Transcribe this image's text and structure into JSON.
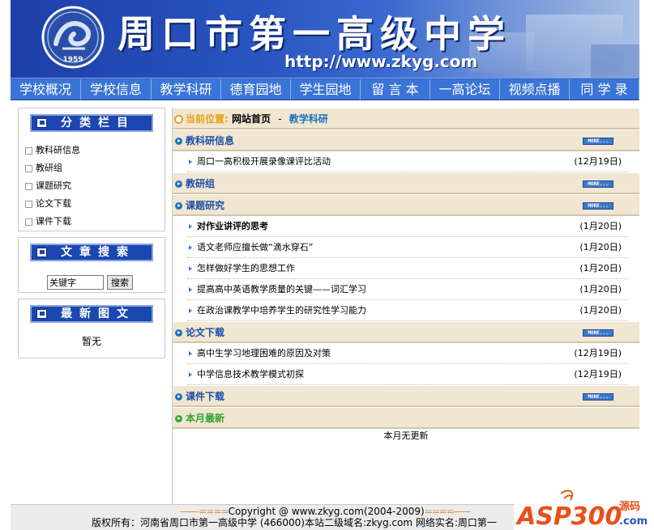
{
  "header": {
    "school_name": "周口市第一高级中学",
    "url": "http://www.zkyg.com",
    "logo_year": "1959"
  },
  "nav": {
    "items": [
      {
        "label": "学校概况"
      },
      {
        "label": "学校信息"
      },
      {
        "label": "教学科研"
      },
      {
        "label": "德育园地"
      },
      {
        "label": "学生园地"
      },
      {
        "label": "留 言 本"
      },
      {
        "label": "一高论坛"
      },
      {
        "label": "视频点播"
      },
      {
        "label": "同 学 录"
      }
    ]
  },
  "sidebar": {
    "categories": {
      "title": "分类栏目",
      "items": [
        "教科研信息",
        "教研组",
        "课题研究",
        "论文下载",
        "课件下载"
      ]
    },
    "search": {
      "title": "文章搜索",
      "input_value": "关键字",
      "button_label": "搜索"
    },
    "latest_images": {
      "title": "最新图文",
      "empty_text": "暂无"
    }
  },
  "main": {
    "location": {
      "label": "当前位置:",
      "home": "网站首页",
      "separator": "-",
      "current": "教学科研"
    },
    "more_label": "MORE...",
    "sections": [
      {
        "title": "教科研信息",
        "items": [
          {
            "title": "周口一高积极开展录像课评比活动",
            "date": "(12月19日)"
          }
        ]
      },
      {
        "title": "教研组",
        "items": []
      },
      {
        "title": "课题研究",
        "items": [
          {
            "title": "对作业讲评的思考",
            "date": "(1月20日)"
          },
          {
            "title": "语文老师应擅长做“滴水穿石”",
            "date": "(1月20日)"
          },
          {
            "title": "怎样做好学生的思想工作",
            "date": "(1月20日)"
          },
          {
            "title": "提高高中英语教学质量的关键——词汇学习",
            "date": "(1月20日)"
          },
          {
            "title": "在政治课教学中培养学生的研究性学习能力",
            "date": "(1月20日)"
          }
        ]
      },
      {
        "title": "论文下载",
        "items": [
          {
            "title": "高中生学习地理困难的原因及对策",
            "date": "(12月19日)"
          },
          {
            "title": "中学信息技术教学模式初探",
            "date": "(12月19日)"
          }
        ]
      },
      {
        "title": "课件下载",
        "items": []
      }
    ],
    "latest": {
      "title": "本月最新",
      "empty_text": "本月无更新"
    }
  },
  "footer": {
    "dashes_left": "-------====",
    "copyright": "Copyright @ www.zkyg.com(2004-2009)",
    "dashes_right": "====------",
    "info": "版权所有：河南省周口市第一高级中学 (466000)本站二级域名:zkyg.com 网络实名:周口第一"
  },
  "watermark": {
    "text": "ASP300",
    "domain": ".com",
    "subtitle": "源码"
  },
  "colors": {
    "banner_blue": "#1d3fa8",
    "nav_blue": "#3a74d6",
    "bar_beige": "#f0e6d2",
    "link_blue": "#1c4ea3",
    "location_orange": "#e8a317",
    "latest_green": "#2fa52f"
  }
}
